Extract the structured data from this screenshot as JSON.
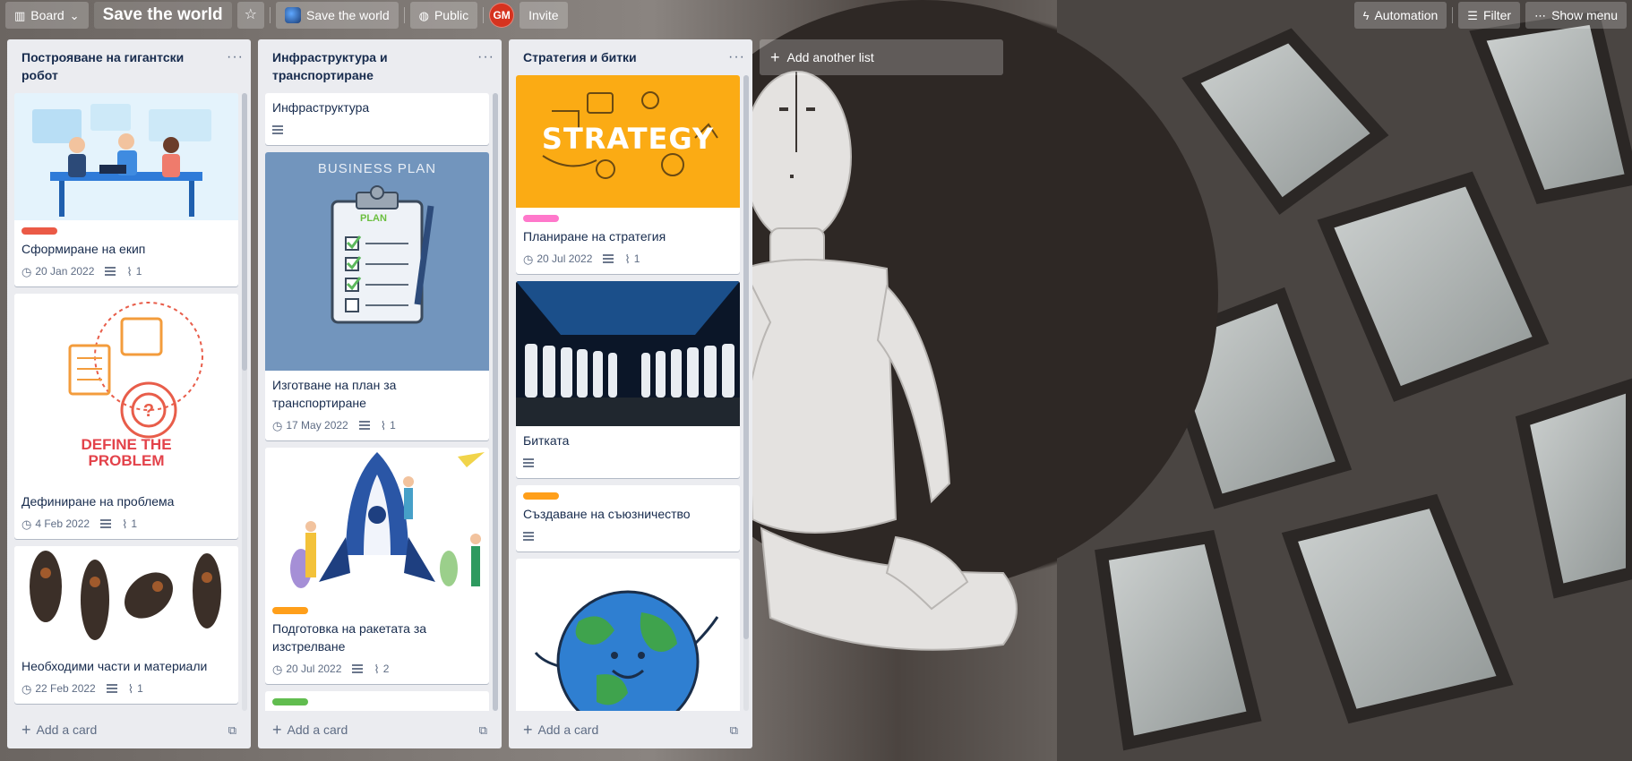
{
  "topbar": {
    "view_label": "Board",
    "board_title": "Save the world",
    "workspace_label": "Save the world",
    "visibility_label": "Public",
    "avatar_initials": "GM",
    "invite_label": "Invite",
    "automation_label": "Automation",
    "filter_label": "Filter",
    "show_menu_label": "Show menu"
  },
  "colors": {
    "label_red": "#eb5a46",
    "label_pink": "#ff78cb",
    "label_orange": "#ff9f1a",
    "label_green": "#61bd4f",
    "strategy_cover": "#fbab14",
    "plan_cover": "#7295bd"
  },
  "lists": [
    {
      "title": "Построяване на гигантски робот",
      "add_card_label": "Add a card",
      "cards": [
        {
          "title": "Сформиране на екип",
          "date": "20 Jan 2022",
          "attachments": "1",
          "cover": "team-meeting-illustration"
        },
        {
          "title": "Дефиниране на проблема",
          "date": "4 Feb 2022",
          "attachments": "1",
          "cover_text_1": "DEFINE THE",
          "cover_text_2": "PROBLEM"
        },
        {
          "title": "Необходими части и материали",
          "date": "22 Feb 2022",
          "attachments": "1",
          "cover": "robot-parts-photo"
        }
      ]
    },
    {
      "title": "Инфраструктура и транспортиране",
      "add_card_label": "Add a card",
      "cards": [
        {
          "title": "Инфраструктура"
        },
        {
          "title": "Изготване на план за транспортиране",
          "date": "17 May 2022",
          "attachments": "1",
          "cover_text_1": "BUSINESS PLAN",
          "cover_text_2": "PLAN"
        },
        {
          "title": "Подготовка на ракетата за изстрелване",
          "date": "20 Jul 2022",
          "attachments": "2",
          "cover": "rocket-launch-illustration"
        }
      ]
    },
    {
      "title": "Стратегия и битки",
      "add_card_label": "Add a card",
      "cards": [
        {
          "title": "Планиране на стратегия",
          "date": "20 Jul 2022",
          "attachments": "1",
          "cover_text_1": "STRATEGY"
        },
        {
          "title": "Битката",
          "cover": "stormtroopers-photo"
        },
        {
          "title": "Създаване на съюзничество"
        },
        {
          "title": "",
          "cover": "happy-earth-illustration"
        }
      ]
    }
  ],
  "add_list_label": "Add another list"
}
